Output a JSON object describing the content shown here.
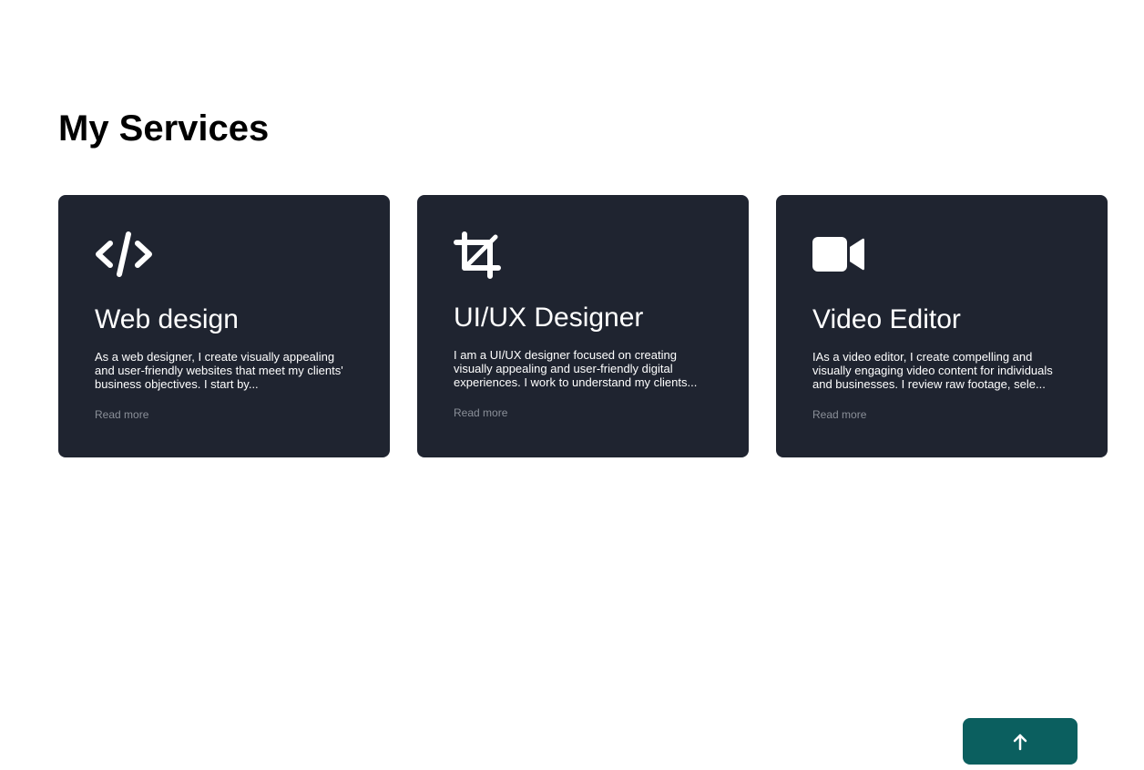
{
  "page_title": "My Services",
  "services": [
    {
      "icon": "code-icon",
      "title": "Web design",
      "description": "As a web designer, I create visually appealing and user-friendly websites that meet my clients' business objectives. I start by...",
      "read_more": "Read more"
    },
    {
      "icon": "crop-icon",
      "title": "UI/UX Designer",
      "description": "I am a UI/UX designer focused on creating visually appealing and user-friendly digital experiences. I work to understand my clients...",
      "read_more": "Read more"
    },
    {
      "icon": "video-camera-icon",
      "title": "Video Editor",
      "description": "IAs a video editor, I create compelling and visually engaging video content for individuals and businesses. I review raw footage, sele...",
      "read_more": "Read more"
    }
  ],
  "scroll_top_button": {
    "icon": "arrow-up-icon"
  },
  "colors": {
    "card_background": "#1f2430",
    "button_background": "#0b5f5f",
    "read_more_text": "#8a8f98"
  }
}
